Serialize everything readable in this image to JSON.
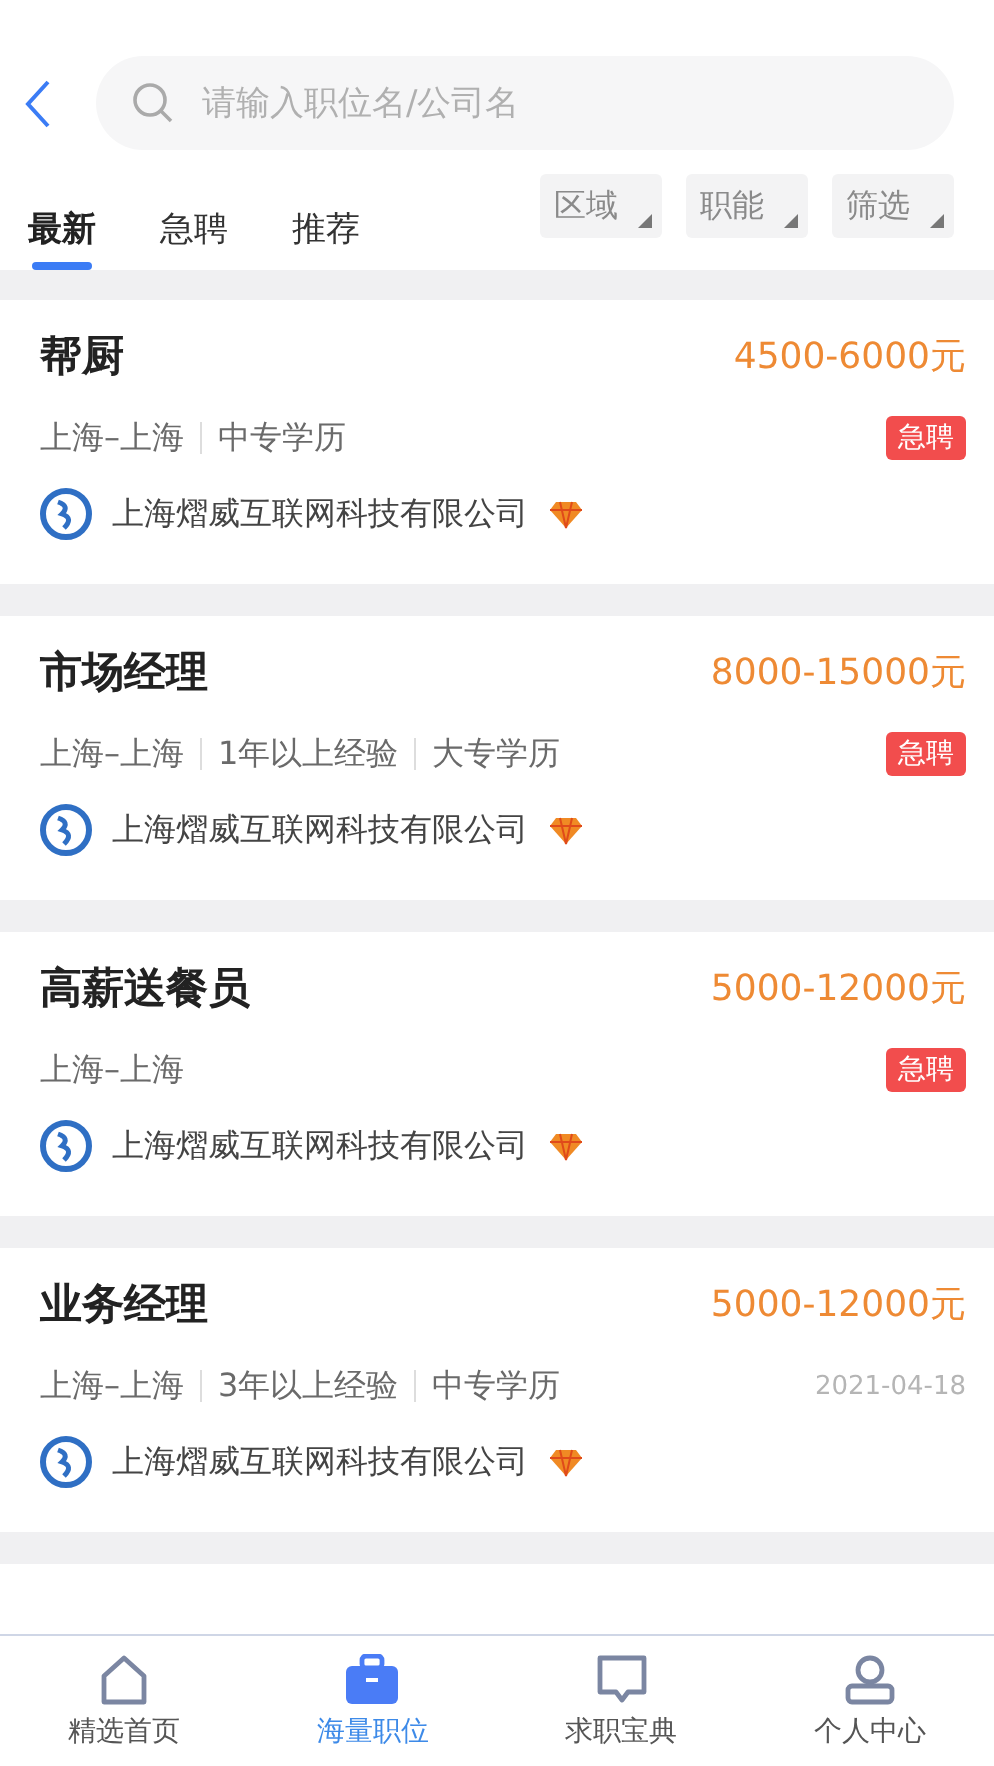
{
  "search": {
    "placeholder": "请输入职位名/公司名"
  },
  "tabs": [
    {
      "label": "最新",
      "selected": true
    },
    {
      "label": "急聘",
      "selected": false
    },
    {
      "label": "推荐",
      "selected": false
    }
  ],
  "filters": [
    "区域",
    "职能",
    "筛选"
  ],
  "jobs": [
    {
      "title": "帮厨",
      "salary": "4500-6000元",
      "meta": [
        "上海–上海",
        "中专学历"
      ],
      "tag": {
        "kind": "urgent",
        "text": "急聘"
      },
      "company": "上海熠威互联网科技有限公司"
    },
    {
      "title": "市场经理",
      "salary": "8000-15000元",
      "meta": [
        "上海–上海",
        "1年以上经验",
        "大专学历"
      ],
      "tag": {
        "kind": "urgent",
        "text": "急聘"
      },
      "company": "上海熠威互联网科技有限公司"
    },
    {
      "title": "高薪送餐员",
      "salary": "5000-12000元",
      "meta": [
        "上海–上海"
      ],
      "tag": {
        "kind": "urgent",
        "text": "急聘"
      },
      "company": "上海熠威互联网科技有限公司"
    },
    {
      "title": "业务经理",
      "salary": "5000-12000元",
      "meta": [
        "上海–上海",
        "3年以上经验",
        "中专学历"
      ],
      "tag": {
        "kind": "date",
        "text": "2021-04-18"
      },
      "company": "上海熠威互联网科技有限公司"
    }
  ],
  "nav": [
    {
      "label": "精选首页",
      "selected": false
    },
    {
      "label": "海量职位",
      "selected": true
    },
    {
      "label": "求职宝典",
      "selected": false
    },
    {
      "label": "个人中心",
      "selected": false
    }
  ]
}
